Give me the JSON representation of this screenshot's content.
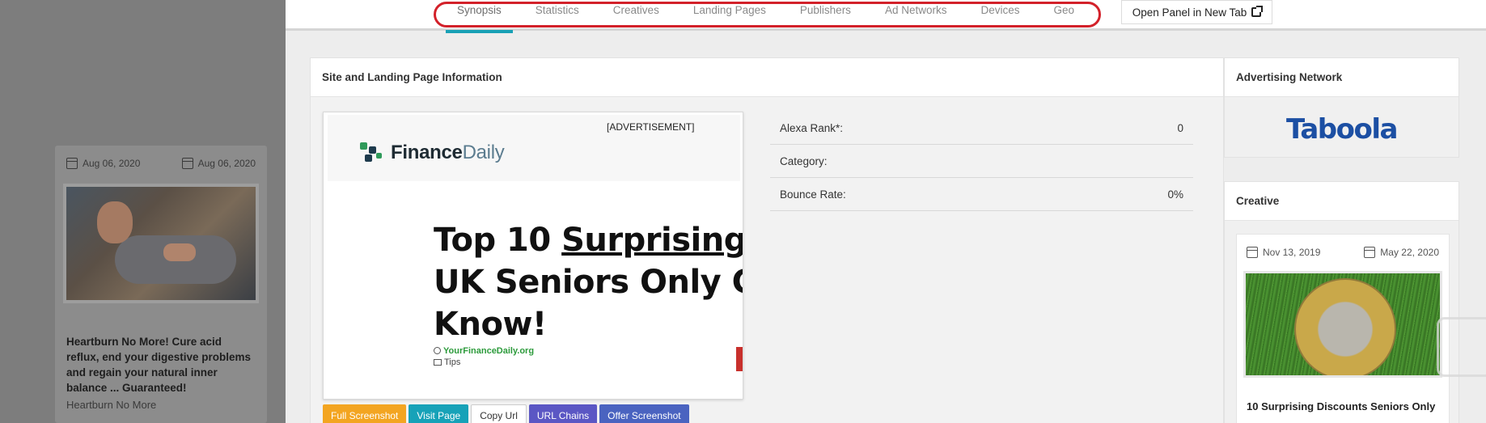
{
  "tabs": [
    {
      "label": "Synopsis",
      "active": true
    },
    {
      "label": "Statistics",
      "active": false
    },
    {
      "label": "Creatives",
      "active": false
    },
    {
      "label": "Landing Pages",
      "active": false
    },
    {
      "label": "Publishers",
      "active": false
    },
    {
      "label": "Ad Networks",
      "active": false
    },
    {
      "label": "Devices",
      "active": false
    },
    {
      "label": "Geo",
      "active": false
    }
  ],
  "open_panel_label": "Open Panel in New Tab",
  "left_card": {
    "date_start": "Aug 06, 2020",
    "date_end": "Aug 06, 2020",
    "title": "Heartburn No More! Cure acid reflux, end your digestive problems and regain your natural inner balance ... Guaranteed!",
    "subtitle": "Heartburn No More"
  },
  "site_panel": {
    "title": "Site and Landing Page Information",
    "ad": {
      "label": "[ADVERTISEMENT]",
      "logo_strong": "Finance",
      "logo_light": "Daily",
      "headline_1a": "Top 10 ",
      "headline_1b": "Surprising Dis",
      "headline_2": "UK Seniors Only Get I",
      "headline_3": "Know!",
      "source": "YourFinanceDaily.org",
      "category_tag": "Tips"
    },
    "info": [
      {
        "label": "Alexa Rank*:",
        "value": "0"
      },
      {
        "label": "Category:",
        "value": ""
      },
      {
        "label": "Bounce Rate:",
        "value": "0%"
      }
    ],
    "buttons": {
      "full_screenshot": "Full Screenshot",
      "visit_page": "Visit Page",
      "copy_url": "Copy Url",
      "url_chains": "URL Chains",
      "offer_screenshot": "Offer Screenshot"
    }
  },
  "ad_network": {
    "title": "Advertising Network",
    "network": "Taboola"
  },
  "creative": {
    "title": "Creative",
    "date_start": "Nov 13, 2019",
    "date_end": "May 22, 2020",
    "card_title": "10 Surprising Discounts Seniors Only"
  },
  "colors": {
    "active_tab": "#18a0b5",
    "highlight_oval": "#d3212a",
    "btn_orange": "#f3a521",
    "btn_teal": "#17a2b8",
    "btn_purple": "#5b57c4",
    "taboola_blue": "#1c4fa3"
  }
}
